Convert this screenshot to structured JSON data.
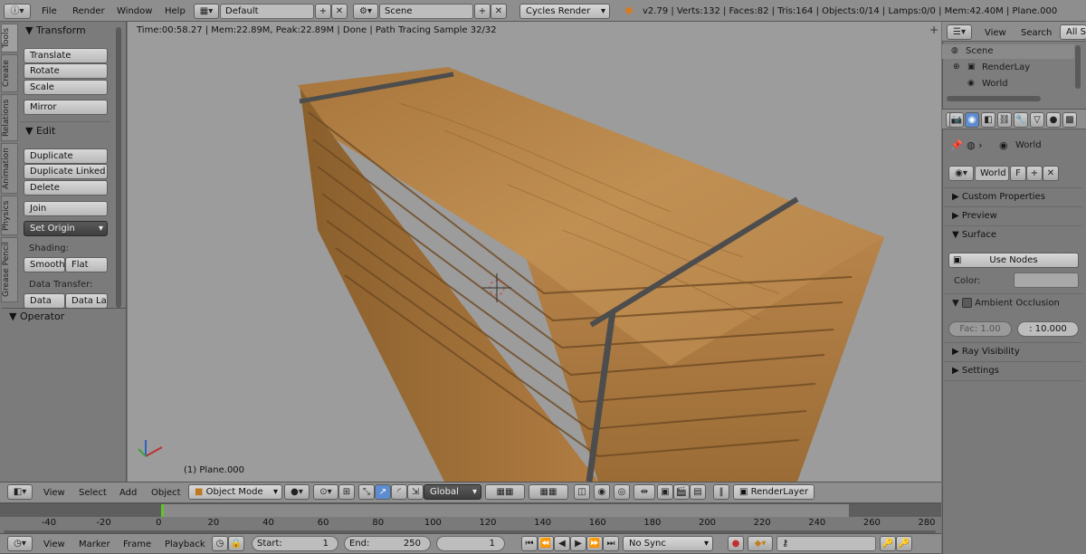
{
  "top_menu": {
    "file": "File",
    "render": "Render",
    "window": "Window",
    "help": "Help"
  },
  "top_bar": {
    "layout": "Default",
    "scene": "Scene",
    "engine": "Cycles Render",
    "stats": "v2.79 | Verts:132 | Faces:82 | Tris:164 | Objects:0/14 | Lamps:0/0 | Mem:42.40M | Plane.000"
  },
  "toolshelf": {
    "tabs": [
      "Tools",
      "Create",
      "Relations",
      "Animation",
      "Physics",
      "Grease Pencil"
    ],
    "transform_header": "Transform",
    "translate": "Translate",
    "rotate": "Rotate",
    "scale": "Scale",
    "mirror": "Mirror",
    "edit_header": "Edit",
    "duplicate": "Duplicate",
    "duplicate_linked": "Duplicate Linked",
    "delete": "Delete",
    "join": "Join",
    "set_origin": "Set Origin",
    "shading_label": "Shading:",
    "smooth": "Smooth",
    "flat": "Flat",
    "data_transfer_label": "Data Transfer:",
    "data": "Data",
    "data_la": "Data La",
    "operator_header": "Operator"
  },
  "viewport": {
    "render_info": "Time:00:58.27 | Mem:22.89M, Peak:22.89M | Done | Path Tracing Sample 32/32",
    "object_label": "(1) Plane.000"
  },
  "view3d_header": {
    "view": "View",
    "select": "Select",
    "add": "Add",
    "object": "Object",
    "mode": "Object Mode",
    "orientation": "Global",
    "render_layer": "RenderLayer"
  },
  "timeline": {
    "ticks": [
      "-40",
      "-20",
      "0",
      "20",
      "40",
      "60",
      "80",
      "100",
      "120",
      "140",
      "160",
      "180",
      "200",
      "220",
      "240",
      "260",
      "280"
    ],
    "current_frame_pct": 0.232
  },
  "timeline_header": {
    "view": "View",
    "marker": "Marker",
    "frame": "Frame",
    "playback": "Playback",
    "start": "Start:",
    "start_val": "1",
    "end": "End:",
    "end_val": "250",
    "current": "1",
    "sync": "No Sync"
  },
  "outliner": {
    "view": "View",
    "search": "Search",
    "all_scenes": "All Sc",
    "scene": "Scene",
    "render_layers": "RenderLay",
    "world": "World"
  },
  "properties": {
    "breadcrumb": "World",
    "world_field": "World",
    "fake_user": "F",
    "custom_properties": "Custom Properties",
    "preview": "Preview",
    "surface": "Surface",
    "use_nodes": "Use Nodes",
    "color_label": "Color:",
    "ambient_occlusion": "Ambient Occlusion",
    "fac": "Fac: 1.00",
    "distance": ": 10.000",
    "ray_visibility": "Ray Visibility",
    "settings": "Settings"
  },
  "colors": {
    "viewport_bg": "#9c9c9c",
    "wood": "#b8864a",
    "strap": "#4d4d4d",
    "panel": "#7a7a7a"
  }
}
